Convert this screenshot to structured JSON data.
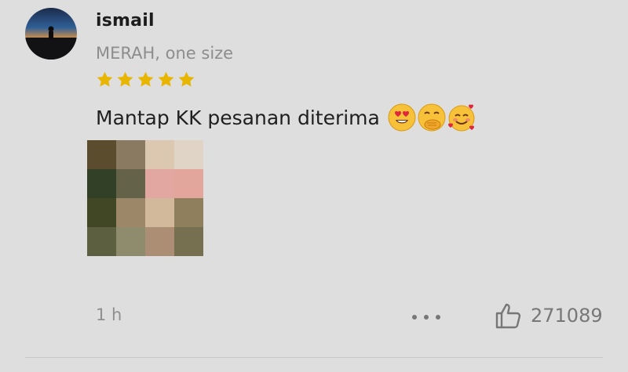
{
  "review": {
    "user": {
      "name": "ismail",
      "avatar_icon": "avatar-icon"
    },
    "variant": "MERAH, one size",
    "rating": {
      "value": 5,
      "max": 5,
      "color": "#e8b500"
    },
    "text": "Mantap KK pesanan diterima",
    "emojis": [
      "heart-eyes-emoji",
      "hand-over-mouth-emoji",
      "smiling-face-with-hearts-emoji"
    ],
    "photo": {
      "icon": "pixelated-photo-thumbnail",
      "pixels": [
        "#5a4c2c",
        "#8b7a62",
        "#dcc8b0",
        "#e0d4c6",
        "#324028",
        "#646248",
        "#e2a7a1",
        "#e2a69d",
        "#414624",
        "#9c8869",
        "#d2b99b",
        "#8f7f5d",
        "#5c6040",
        "#8f8c6d",
        "#ab8e73",
        "#766f50"
      ]
    },
    "time": "1 h",
    "more_icon": "more-dots-icon",
    "like": {
      "icon": "thumbs-up-icon",
      "count": "271089"
    }
  }
}
